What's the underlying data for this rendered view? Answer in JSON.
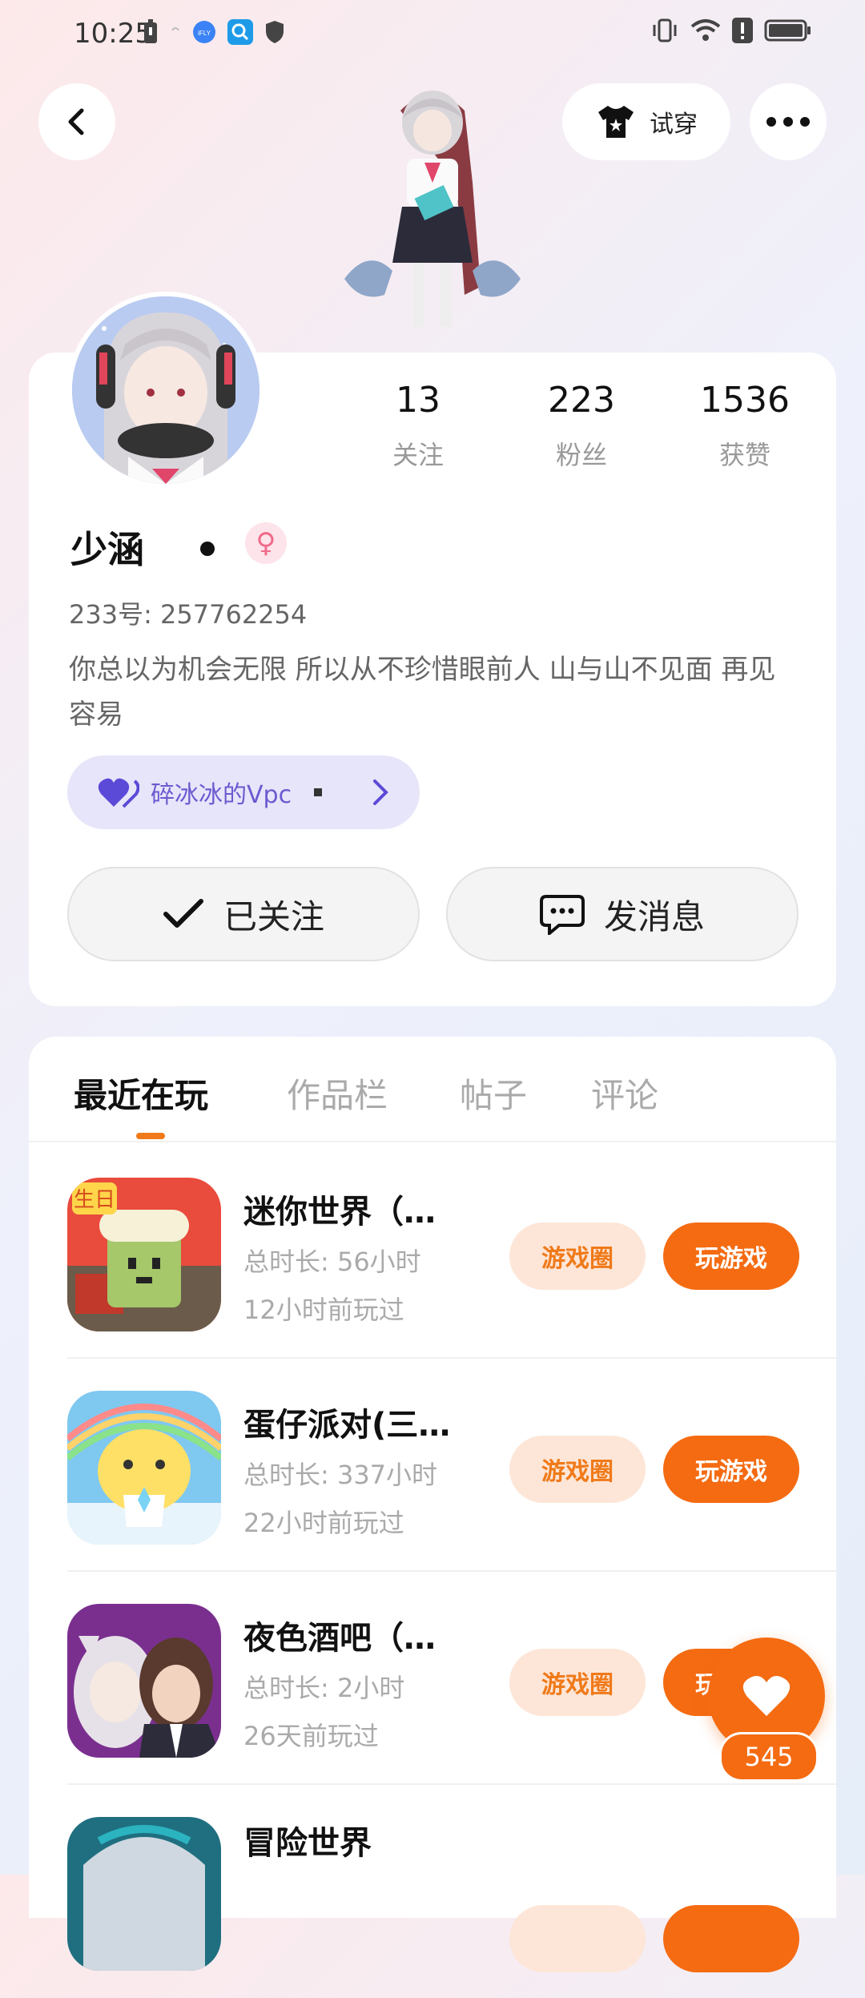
{
  "status_bar": {
    "time": "10:25",
    "left_icons": [
      "battery-saver-icon",
      "dot-icon",
      "iflytek-icon",
      "search-app-icon",
      "shield-icon"
    ],
    "right_icons": [
      "vibrate-icon",
      "wifi-icon",
      "alert-icon",
      "battery-icon"
    ]
  },
  "header": {
    "try_on_label": "试穿"
  },
  "profile": {
    "stats": [
      {
        "value": "13",
        "label": "关注"
      },
      {
        "value": "223",
        "label": "粉丝"
      },
      {
        "value": "1536",
        "label": "获赞"
      }
    ],
    "nickname": "少涵",
    "gender_symbol": "♀",
    "uid_line": "233号:  257762254",
    "bio": "你总以为机会无限 所以从不珍惜眼前人 山与山不见面 再见容易",
    "vpc_chip_label": "碎冰冰的Vpc",
    "follow_button_label": "已关注",
    "message_button_label": "发消息"
  },
  "tabs": [
    {
      "label": "最近在玩",
      "active": true
    },
    {
      "label": "作品栏",
      "active": false
    },
    {
      "label": "帖子",
      "active": false
    },
    {
      "label": "评论",
      "active": false
    }
  ],
  "games": [
    {
      "name": "迷你世界（…",
      "duration": "总时长:  56小时",
      "last_played": "12小时前玩过",
      "circle_label": "游戏圈",
      "play_label": "玩游戏"
    },
    {
      "name": "蛋仔派对(三…",
      "duration": "总时长:  337小时",
      "last_played": "22小时前玩过",
      "circle_label": "游戏圈",
      "play_label": "玩游戏"
    },
    {
      "name": "夜色酒吧（…",
      "duration": "总时长:  2小时",
      "last_played": "26天前玩过",
      "circle_label": "游戏圈",
      "play_label": "玩游戏"
    },
    {
      "name": "冒险世界",
      "duration": "",
      "last_played": "",
      "circle_label": "",
      "play_label": ""
    }
  ],
  "like_fab": {
    "count": "545"
  },
  "colors": {
    "accent": "#f46b12",
    "accent_light": "#fde6d8",
    "vpc_chip_bg": "#e7e5fa",
    "vpc_text": "#6a5bd0"
  }
}
